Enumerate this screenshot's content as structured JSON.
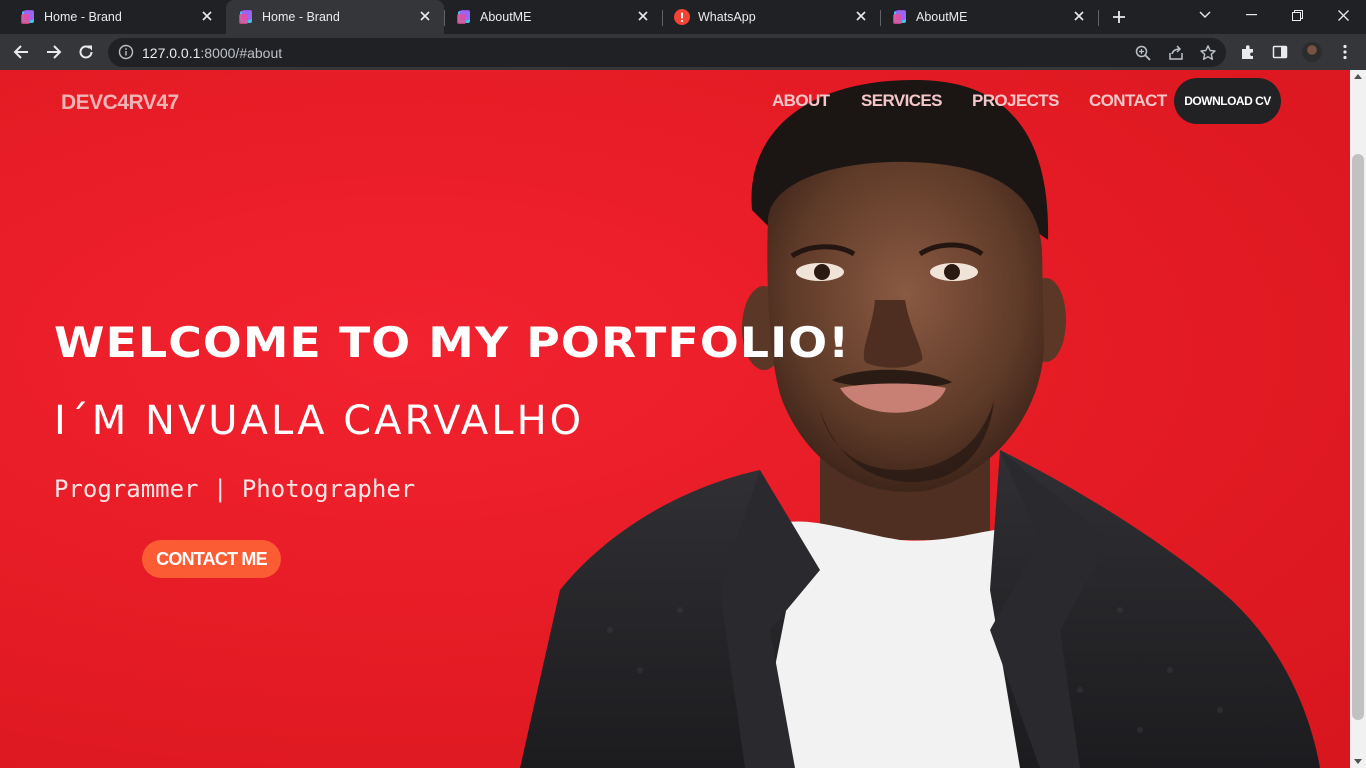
{
  "browser": {
    "tabs": [
      {
        "title": "Home - Brand",
        "favicon": "brand-logo-icon"
      },
      {
        "title": "Home - Brand",
        "favicon": "brand-logo-icon"
      },
      {
        "title": "AboutME",
        "favicon": "brand-logo-icon"
      },
      {
        "title": "WhatsApp",
        "favicon": "error-icon"
      },
      {
        "title": "AboutME",
        "favicon": "brand-logo-icon"
      }
    ],
    "active_tab_index": 1,
    "address": {
      "host": "127.0.0.1",
      "path": ":8000/#about"
    }
  },
  "site": {
    "brand": "DEVC4RV47",
    "nav": [
      "ABOUT",
      "SERVICES",
      "PROJECTS",
      "CONTACT"
    ],
    "download_cv": "DOWNLOAD CV"
  },
  "hero": {
    "headline": "WELCOME TO MY PORTFOLIO!",
    "name_line": "I´M NVUALA CARVALHO",
    "roles": "Programmer | Photographer",
    "cta": "CONTACT ME"
  },
  "colors": {
    "hero_background": "#e41b24",
    "cta_button": "#fb5c34",
    "download_button": "#222225",
    "browser_chrome": "#202124"
  }
}
